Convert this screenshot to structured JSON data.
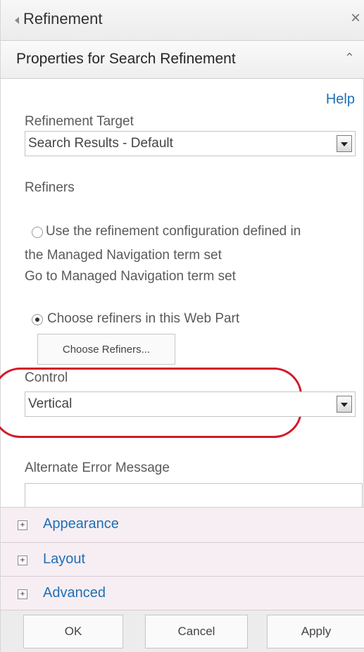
{
  "header": {
    "title": "Refinement",
    "close_icon": "×"
  },
  "section": {
    "title": "Properties for Search Refinement",
    "toggle_icon": "⌃"
  },
  "help_link": "Help",
  "refinement_target": {
    "label": "Refinement Target",
    "value": "Search Results - Default"
  },
  "refiners": {
    "label": "Refiners",
    "option_managed_line1": "Use the refinement configuration defined in",
    "option_managed_line2": "the Managed Navigation term set",
    "managed_link": "Go to Managed Navigation term set",
    "option_webpart": "Choose refiners in this Web Part",
    "choose_button": "Choose Refiners..."
  },
  "control": {
    "label": "Control",
    "value": "Vertical"
  },
  "alt_error": {
    "label": "Alternate Error Message",
    "value": ""
  },
  "groups": [
    {
      "label": "Appearance"
    },
    {
      "label": "Layout"
    },
    {
      "label": "Advanced"
    }
  ],
  "footer": {
    "ok": "OK",
    "cancel": "Cancel",
    "apply": "Apply"
  },
  "colors": {
    "link": "#1f6fb5",
    "highlight": "#d11a2a",
    "group_bg": "#f7eef3"
  }
}
